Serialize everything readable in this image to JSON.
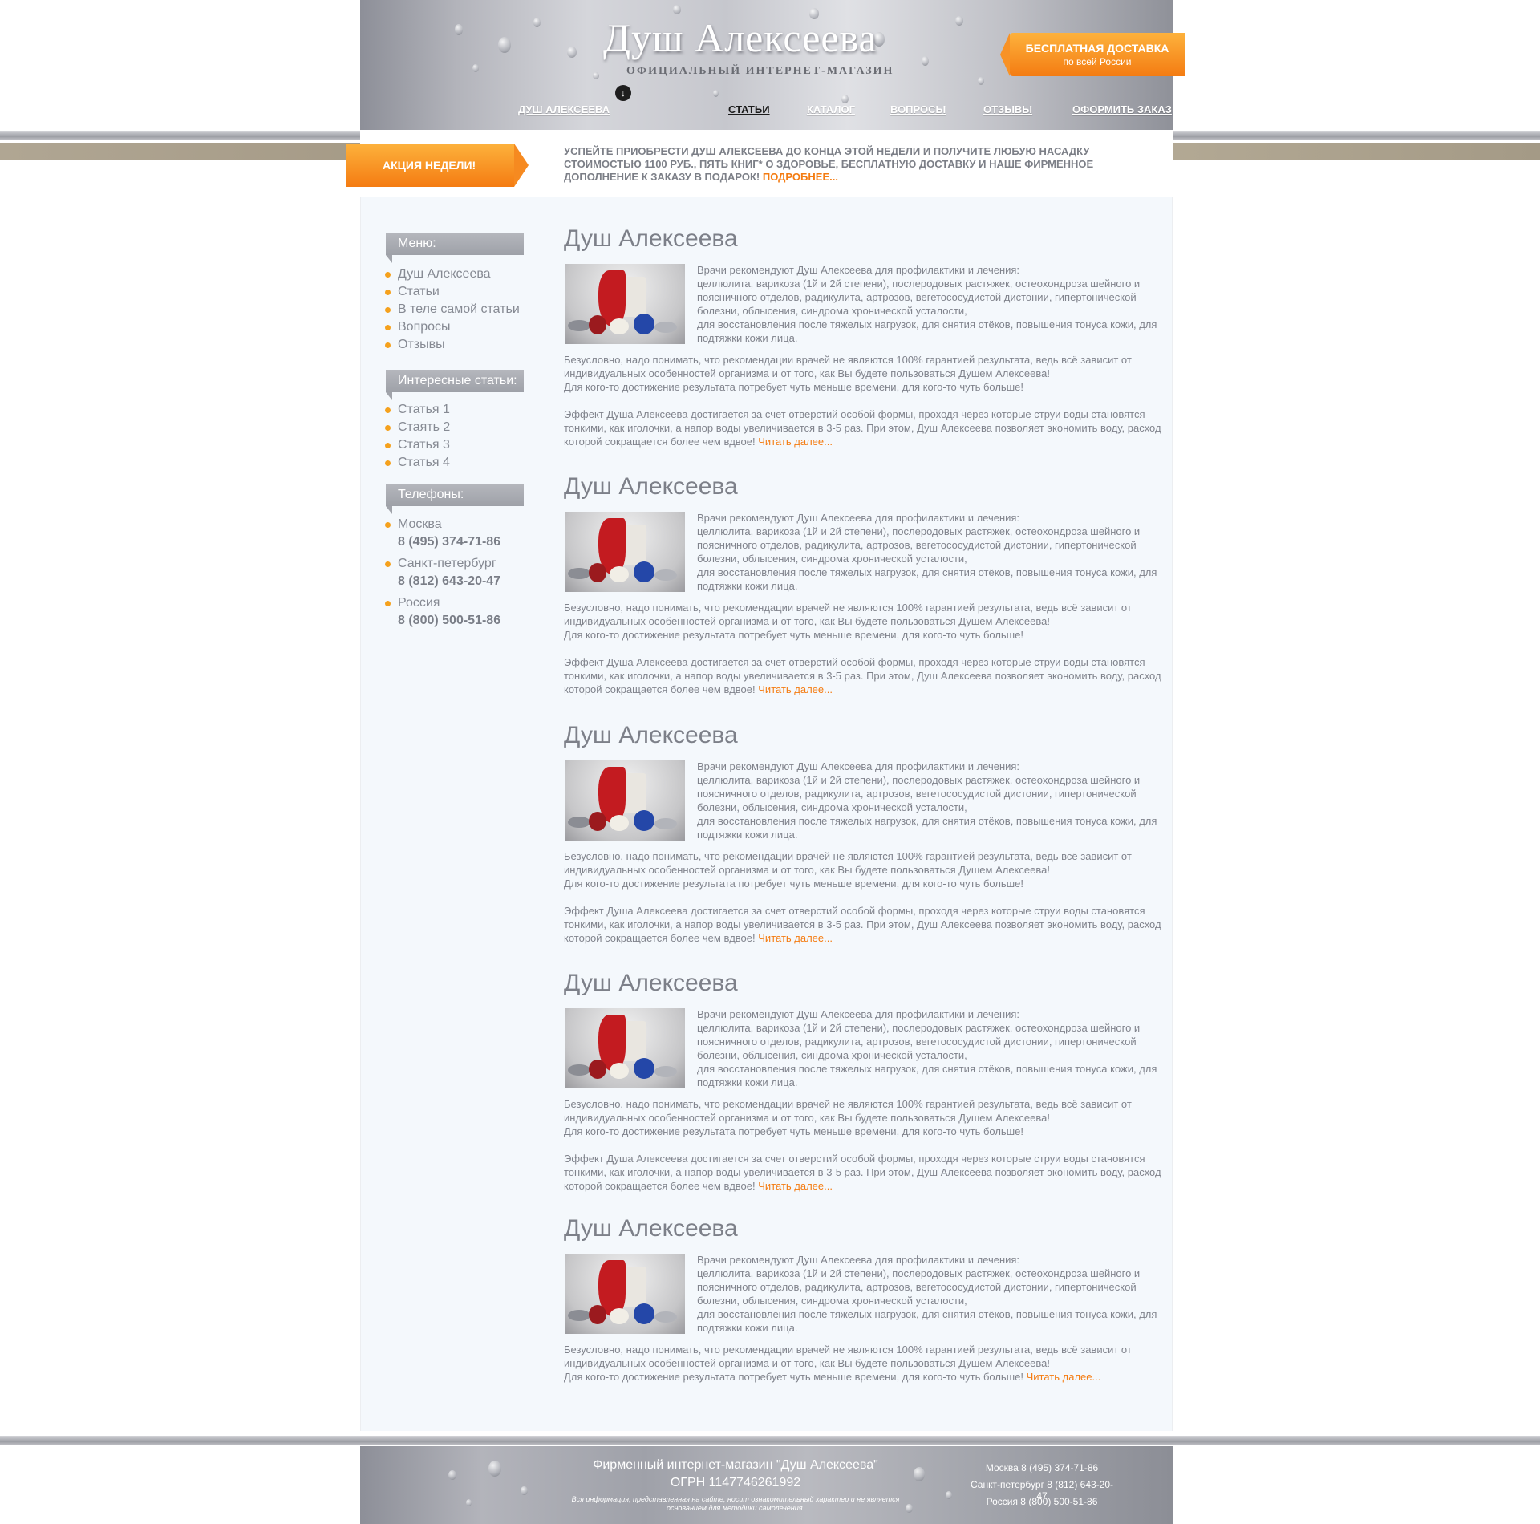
{
  "header": {
    "logo_title": "Душ Алексеева",
    "logo_subtitle": "ОФИЦИАЛЬНЫЙ ИНТЕРНЕТ-МАГАЗИН",
    "delivery_title": "БЕСПЛАТНАЯ ДОСТАВКА",
    "delivery_sub": "по всей России"
  },
  "nav": {
    "active": "СТАТЬИ",
    "items": [
      {
        "label": "ДУШ АЛЕКСЕЕВА"
      },
      {
        "label": "СТАТЬИ"
      },
      {
        "label": "КАТАЛОГ"
      },
      {
        "label": "ВОПРОСЫ"
      },
      {
        "label": "ОТЗЫВЫ"
      },
      {
        "label": "ОФОРМИТЬ ЗАКАЗ"
      }
    ]
  },
  "promo": {
    "badge": "АКЦИЯ НЕДЕЛИ!",
    "text": "УСПЕЙТЕ ПРИОБРЕСТИ ДУШ АЛЕКСЕЕВА ДО КОНЦА ЭТОЙ НЕДЕЛИ И ПОЛУЧИТЕ ЛЮБУЮ НАСАДКУ СТОИМОСТЬЮ 1100 РУБ., ПЯТЬ КНИГ* О ЗДОРОВЬЕ, БЕСПЛАТНУЮ ДОСТАВКУ И НАШЕ ФИРМЕННОЕ ДОПОЛНЕНИЕ К ЗАКАЗУ В ПОДАРОК!",
    "more": "ПОДРОБНЕЕ..."
  },
  "sidebar": {
    "menu_title": "Меню:",
    "menu_items": [
      "Душ Алексеева",
      "Статьи",
      "В теле самой статьи",
      "Вопросы",
      "Отзывы"
    ],
    "articles_title": "Интересные статьи:",
    "article_items": [
      "Статья 1",
      "Стаять 2",
      "Статья 3",
      "Статья 4"
    ],
    "phones_title": "Телефоны:",
    "phones": [
      {
        "city": "Москва",
        "number": "8 (495) 374-71-86"
      },
      {
        "city": "Санкт-петербург",
        "number": "8 (812) 643-20-47"
      },
      {
        "city": "Россия",
        "number": "8 (800) 500-51-86"
      }
    ]
  },
  "articles": [
    {
      "title": "Душ Алексеева",
      "intro": "Врачи рекомендуют Душ Алексеева для профилактики и лечения:\nцеллюлита, варикоза (1й и 2й степени), послеродовых растяжек, остеохондроза шейного и поясничного отделов, радикулита,  артрозов, вегетососудистой дистонии, гипертонической болезни,  облысения, синдрома хронической усталости,\nдля восстановления после тяжелых нагрузок, для снятия отёков, повышения тонуса кожи, для подтяжки кожи лица.",
      "body": "Безусловно, надо понимать, что рекомендации врачей не являются 100% гарантией результата, ведь всё зависит от индивидуальных особенностей организма и от того, как Вы будете пользоваться Душем Алексеева!\nДля кого-то достижение результата потребует чуть меньше времени, для кого-то чуть больше!\n\nЭффект Душа Алексеева достигается за счет отверстий особой формы, проходя через которые струи воды становятся тонкими, как иголочки, а напор воды увеличивается в 3-5 раз. При этом, Душ Алексеева позволяет экономить воду, расход которой сокращается более чем вдвое!",
      "more": "Читать далее..."
    },
    {
      "title": "Душ Алексеева",
      "intro": "Врачи рекомендуют Душ Алексеева для профилактики и лечения:\nцеллюлита, варикоза (1й и 2й степени), послеродовых растяжек, остеохондроза шейного и поясничного отделов, радикулита,  артрозов, вегетососудистой дистонии, гипертонической болезни,  облысения, синдрома хронической усталости,\nдля восстановления после тяжелых нагрузок, для снятия отёков, повышения тонуса кожи, для подтяжки кожи лица.",
      "body": "Безусловно, надо понимать, что рекомендации врачей не являются 100% гарантией результата, ведь всё зависит от индивидуальных особенностей организма и от того, как Вы будете пользоваться Душем Алексеева!\nДля кого-то достижение результата потребует чуть меньше времени, для кого-то чуть больше!\n\nЭффект Душа Алексеева достигается за счет отверстий особой формы, проходя через которые струи воды становятся тонкими, как иголочки, а напор воды увеличивается в 3-5 раз. При этом, Душ Алексеева позволяет экономить воду, расход которой сокращается более чем вдвое!",
      "more": "Читать далее..."
    },
    {
      "title": "Душ Алексеева",
      "intro": "Врачи рекомендуют Душ Алексеева для профилактики и лечения:\nцеллюлита, варикоза (1й и 2й степени), послеродовых растяжек, остеохондроза шейного и поясничного отделов, радикулита,  артрозов, вегетососудистой дистонии, гипертонической болезни,  облысения, синдрома хронической усталости,\nдля восстановления после тяжелых нагрузок, для снятия отёков, повышения тонуса кожи, для подтяжки кожи лица.",
      "body": "Безусловно, надо понимать, что рекомендации врачей не являются 100% гарантией результата, ведь всё зависит от индивидуальных особенностей организма и от того, как Вы будете пользоваться Душем Алексеева!\nДля кого-то достижение результата потребует чуть меньше времени, для кого-то чуть больше!\n\nЭффект Душа Алексеева достигается за счет отверстий особой формы, проходя через которые струи воды становятся тонкими, как иголочки, а напор воды увеличивается в 3-5 раз. При этом, Душ Алексеева позволяет экономить воду, расход которой сокращается более чем вдвое!",
      "more": "Читать далее..."
    },
    {
      "title": "Душ Алексеева",
      "intro": "Врачи рекомендуют Душ Алексеева для профилактики и лечения:\nцеллюлита, варикоза (1й и 2й степени), послеродовых растяжек, остеохондроза шейного и поясничного отделов, радикулита,  артрозов, вегетососудистой дистонии, гипертонической болезни,  облысения, синдрома хронической усталости,\nдля восстановления после тяжелых нагрузок, для снятия отёков, повышения тонуса кожи, для подтяжки кожи лица.",
      "body": "Безусловно, надо понимать, что рекомендации врачей не являются 100% гарантией результата, ведь всё зависит от индивидуальных особенностей организма и от того, как Вы будете пользоваться Душем Алексеева!\nДля кого-то достижение результата потребует чуть меньше времени, для кого-то чуть больше!\n\nЭффект Душа Алексеева достигается за счет отверстий особой формы, проходя через которые струи воды становятся тонкими, как иголочки, а напор воды увеличивается в 3-5 раз. При этом, Душ Алексеева позволяет экономить воду, расход которой сокращается более чем вдвое!",
      "more": "Читать далее..."
    },
    {
      "title": "Душ Алексеева",
      "intro": "Врачи рекомендуют Душ Алексеева для профилактики и лечения:\nцеллюлита, варикоза (1й и 2й степени), послеродовых растяжек, остеохондроза шейного и поясничного отделов, радикулита,  артрозов, вегетососудистой дистонии, гипертонической болезни,  облысения, синдрома хронической усталости,\nдля восстановления после тяжелых нагрузок, для снятия отёков, повышения тонуса кожи, для подтяжки кожи лица.",
      "body": "Безусловно, надо понимать, что рекомендации врачей не являются 100% гарантией результата, ведь всё зависит от индивидуальных особенностей организма и от того, как Вы будете пользоваться Душем Алексеева!\nДля кого-то достижение результата потребует чуть меньше времени, для кого-то чуть больше!",
      "more": "Читать далее..."
    }
  ],
  "footer": {
    "title": "Фирменный интернет-магазин \"Душ Алексеева\"",
    "ogrn": "ОГРН 1147746261992",
    "note": "Вся информация, представленная на сайте, носит ознакомительный характер и не является основанием для методики самолечения.",
    "phones": [
      "Москва 8 (495) 374-71-86",
      "Санкт-петербург 8 (812) 643-20-47",
      "Россия 8 (800) 500-51-86"
    ]
  },
  "colors": {
    "accent": "#f47c12",
    "bullet": "#f5a11d",
    "text": "#7a7e87",
    "content_bg": "#f4f8fc"
  },
  "icons": {
    "nav_active": "arrow-down-icon",
    "bullets": "orange-dot-icon",
    "decor": "water-drop-icon"
  }
}
